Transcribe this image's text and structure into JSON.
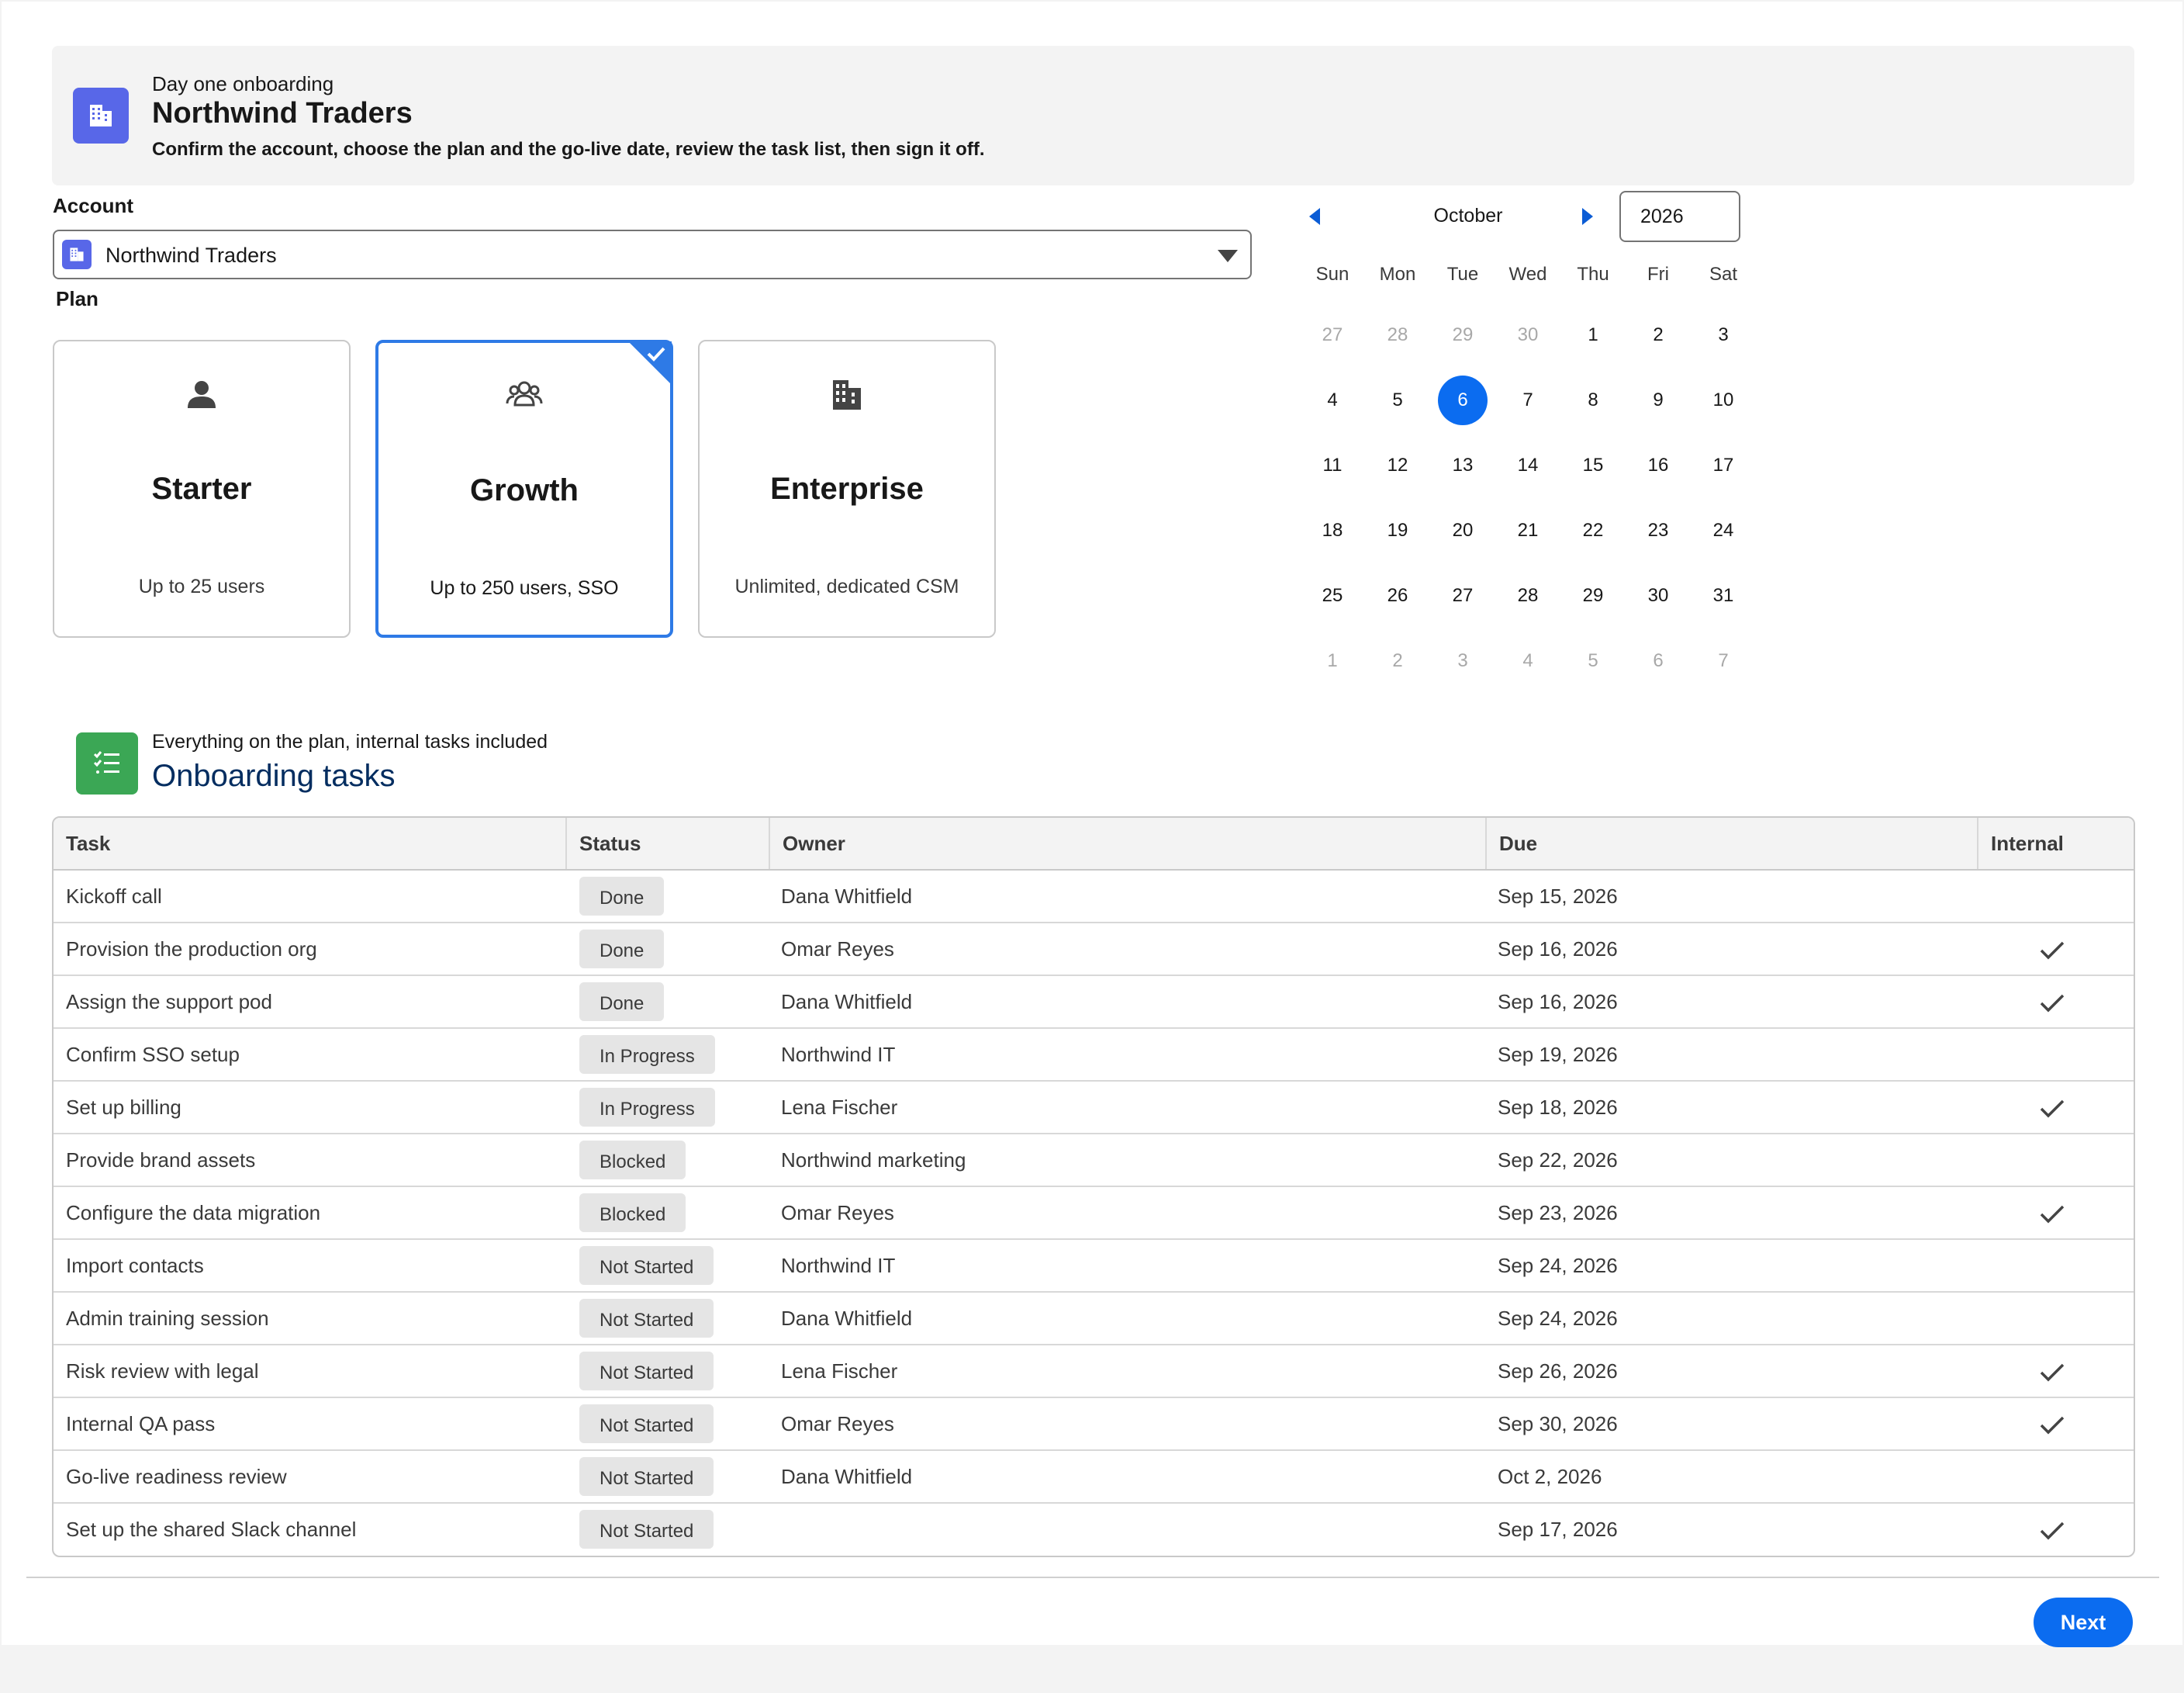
{
  "header": {
    "eyebrow": "Day one onboarding",
    "title": "Northwind Traders",
    "description": "Confirm the account, choose the plan and the go-live date, review the task list, then sign it off.",
    "icon": "building-icon",
    "accent": "#5867e8"
  },
  "account": {
    "label": "Account",
    "value": "Northwind Traders",
    "icon": "building-icon"
  },
  "plan": {
    "label": "Plan",
    "selected": "Growth",
    "options": [
      {
        "name": "Starter",
        "sub": "Up to 25 users",
        "icon": "user-icon",
        "selected": false
      },
      {
        "name": "Growth",
        "sub": "Up to 250 users, SSO",
        "icon": "group-icon",
        "selected": true
      },
      {
        "name": "Enterprise",
        "sub": "Unlimited, dedicated CSM",
        "icon": "buildings-icon",
        "selected": false
      }
    ],
    "selected_color": "#2e7ae6"
  },
  "calendar": {
    "month": "October",
    "year": "2026",
    "selected_day": "6",
    "weekdays": [
      "Sun",
      "Mon",
      "Tue",
      "Wed",
      "Thu",
      "Fri",
      "Sat"
    ],
    "weeks": [
      [
        {
          "d": "27",
          "m": true
        },
        {
          "d": "28",
          "m": true
        },
        {
          "d": "29",
          "m": true
        },
        {
          "d": "30",
          "m": true
        },
        {
          "d": "1"
        },
        {
          "d": "2"
        },
        {
          "d": "3"
        }
      ],
      [
        {
          "d": "4"
        },
        {
          "d": "5"
        },
        {
          "d": "6",
          "s": true
        },
        {
          "d": "7"
        },
        {
          "d": "8"
        },
        {
          "d": "9"
        },
        {
          "d": "10"
        }
      ],
      [
        {
          "d": "11"
        },
        {
          "d": "12"
        },
        {
          "d": "13"
        },
        {
          "d": "14"
        },
        {
          "d": "15"
        },
        {
          "d": "16"
        },
        {
          "d": "17"
        }
      ],
      [
        {
          "d": "18"
        },
        {
          "d": "19"
        },
        {
          "d": "20"
        },
        {
          "d": "21"
        },
        {
          "d": "22"
        },
        {
          "d": "23"
        },
        {
          "d": "24"
        }
      ],
      [
        {
          "d": "25"
        },
        {
          "d": "26"
        },
        {
          "d": "27"
        },
        {
          "d": "28"
        },
        {
          "d": "29"
        },
        {
          "d": "30"
        },
        {
          "d": "31"
        }
      ],
      [
        {
          "d": "1",
          "m": true
        },
        {
          "d": "2",
          "m": true
        },
        {
          "d": "3",
          "m": true
        },
        {
          "d": "4",
          "m": true
        },
        {
          "d": "5",
          "m": true
        },
        {
          "d": "6",
          "m": true
        },
        {
          "d": "7",
          "m": true
        }
      ]
    ],
    "accent": "#0b6cf0"
  },
  "tasks": {
    "eyebrow": "Everything on the plan, internal tasks included",
    "title": "Onboarding tasks",
    "icon": "task-list-icon",
    "columns": [
      "Task",
      "Status",
      "Owner",
      "Due",
      "Internal"
    ],
    "rows": [
      {
        "task": "Kickoff call",
        "status": "Done",
        "owner": "Dana Whitfield",
        "due": "Sep 15, 2026",
        "internal": false
      },
      {
        "task": "Provision the production org",
        "status": "Done",
        "owner": "Omar Reyes",
        "due": "Sep 16, 2026",
        "internal": true
      },
      {
        "task": "Assign the support pod",
        "status": "Done",
        "owner": "Dana Whitfield",
        "due": "Sep 16, 2026",
        "internal": true
      },
      {
        "task": "Confirm SSO setup",
        "status": "In Progress",
        "owner": "Northwind IT",
        "due": "Sep 19, 2026",
        "internal": false
      },
      {
        "task": "Set up billing",
        "status": "In Progress",
        "owner": "Lena Fischer",
        "due": "Sep 18, 2026",
        "internal": true
      },
      {
        "task": "Provide brand assets",
        "status": "Blocked",
        "owner": "Northwind marketing",
        "due": "Sep 22, 2026",
        "internal": false
      },
      {
        "task": "Configure the data migration",
        "status": "Blocked",
        "owner": "Omar Reyes",
        "due": "Sep 23, 2026",
        "internal": true
      },
      {
        "task": "Import contacts",
        "status": "Not Started",
        "owner": "Northwind IT",
        "due": "Sep 24, 2026",
        "internal": false
      },
      {
        "task": "Admin training session",
        "status": "Not Started",
        "owner": "Dana Whitfield",
        "due": "Sep 24, 2026",
        "internal": false
      },
      {
        "task": "Risk review with legal",
        "status": "Not Started",
        "owner": "Lena Fischer",
        "due": "Sep 26, 2026",
        "internal": true
      },
      {
        "task": "Internal QA pass",
        "status": "Not Started",
        "owner": "Omar Reyes",
        "due": "Sep 30, 2026",
        "internal": true
      },
      {
        "task": "Go-live readiness review",
        "status": "Not Started",
        "owner": "Dana Whitfield",
        "due": "Oct 2, 2026",
        "internal": false
      },
      {
        "task": "Set up the shared Slack channel",
        "status": "Not Started",
        "owner": "",
        "due": "Sep 17, 2026",
        "internal": true
      }
    ]
  },
  "footer": {
    "next_label": "Next",
    "accent": "#0b6cf0"
  }
}
